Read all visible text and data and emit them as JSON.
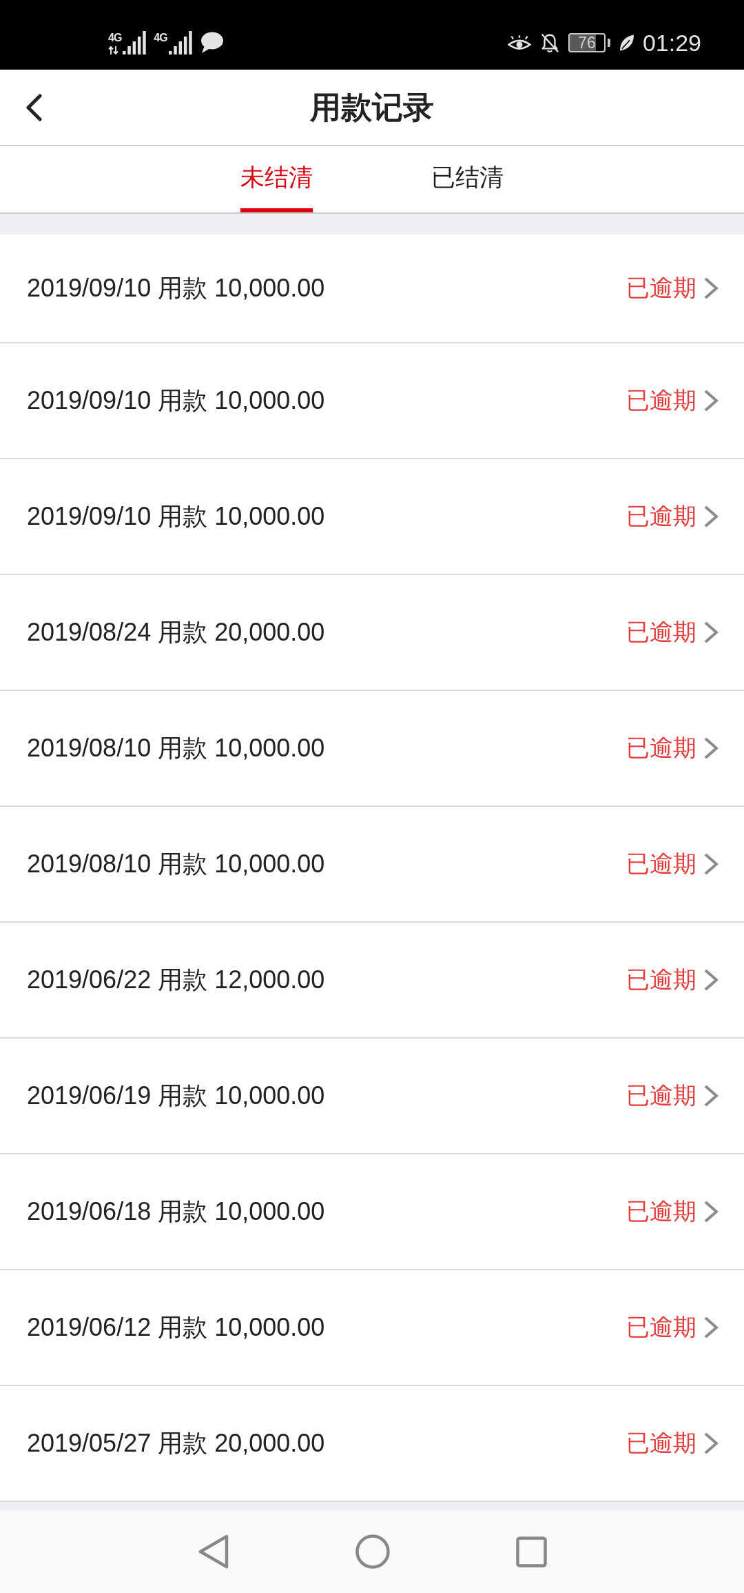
{
  "status_bar": {
    "signals": [
      {
        "label": "4G",
        "data_active": true
      },
      {
        "label": "4G",
        "data_active": false
      }
    ],
    "battery": "76",
    "time": "01:29"
  },
  "header": {
    "title": "用款记录"
  },
  "tabs": [
    {
      "label": "未结清",
      "selected": true
    },
    {
      "label": "已结清",
      "selected": false
    }
  ],
  "records": [
    {
      "text": "2019/09/10 用款 10,000.00",
      "status": "已逾期"
    },
    {
      "text": "2019/09/10 用款 10,000.00",
      "status": "已逾期"
    },
    {
      "text": "2019/09/10 用款 10,000.00",
      "status": "已逾期"
    },
    {
      "text": "2019/08/24 用款 20,000.00",
      "status": "已逾期"
    },
    {
      "text": "2019/08/10 用款 10,000.00",
      "status": "已逾期"
    },
    {
      "text": "2019/08/10 用款 10,000.00",
      "status": "已逾期"
    },
    {
      "text": "2019/06/22 用款 12,000.00",
      "status": "已逾期"
    },
    {
      "text": "2019/06/19 用款 10,000.00",
      "status": "已逾期"
    },
    {
      "text": "2019/06/18 用款 10,000.00",
      "status": "已逾期"
    },
    {
      "text": "2019/06/12 用款 10,000.00",
      "status": "已逾期"
    },
    {
      "text": "2019/05/27 用款 20,000.00",
      "status": "已逾期"
    }
  ]
}
